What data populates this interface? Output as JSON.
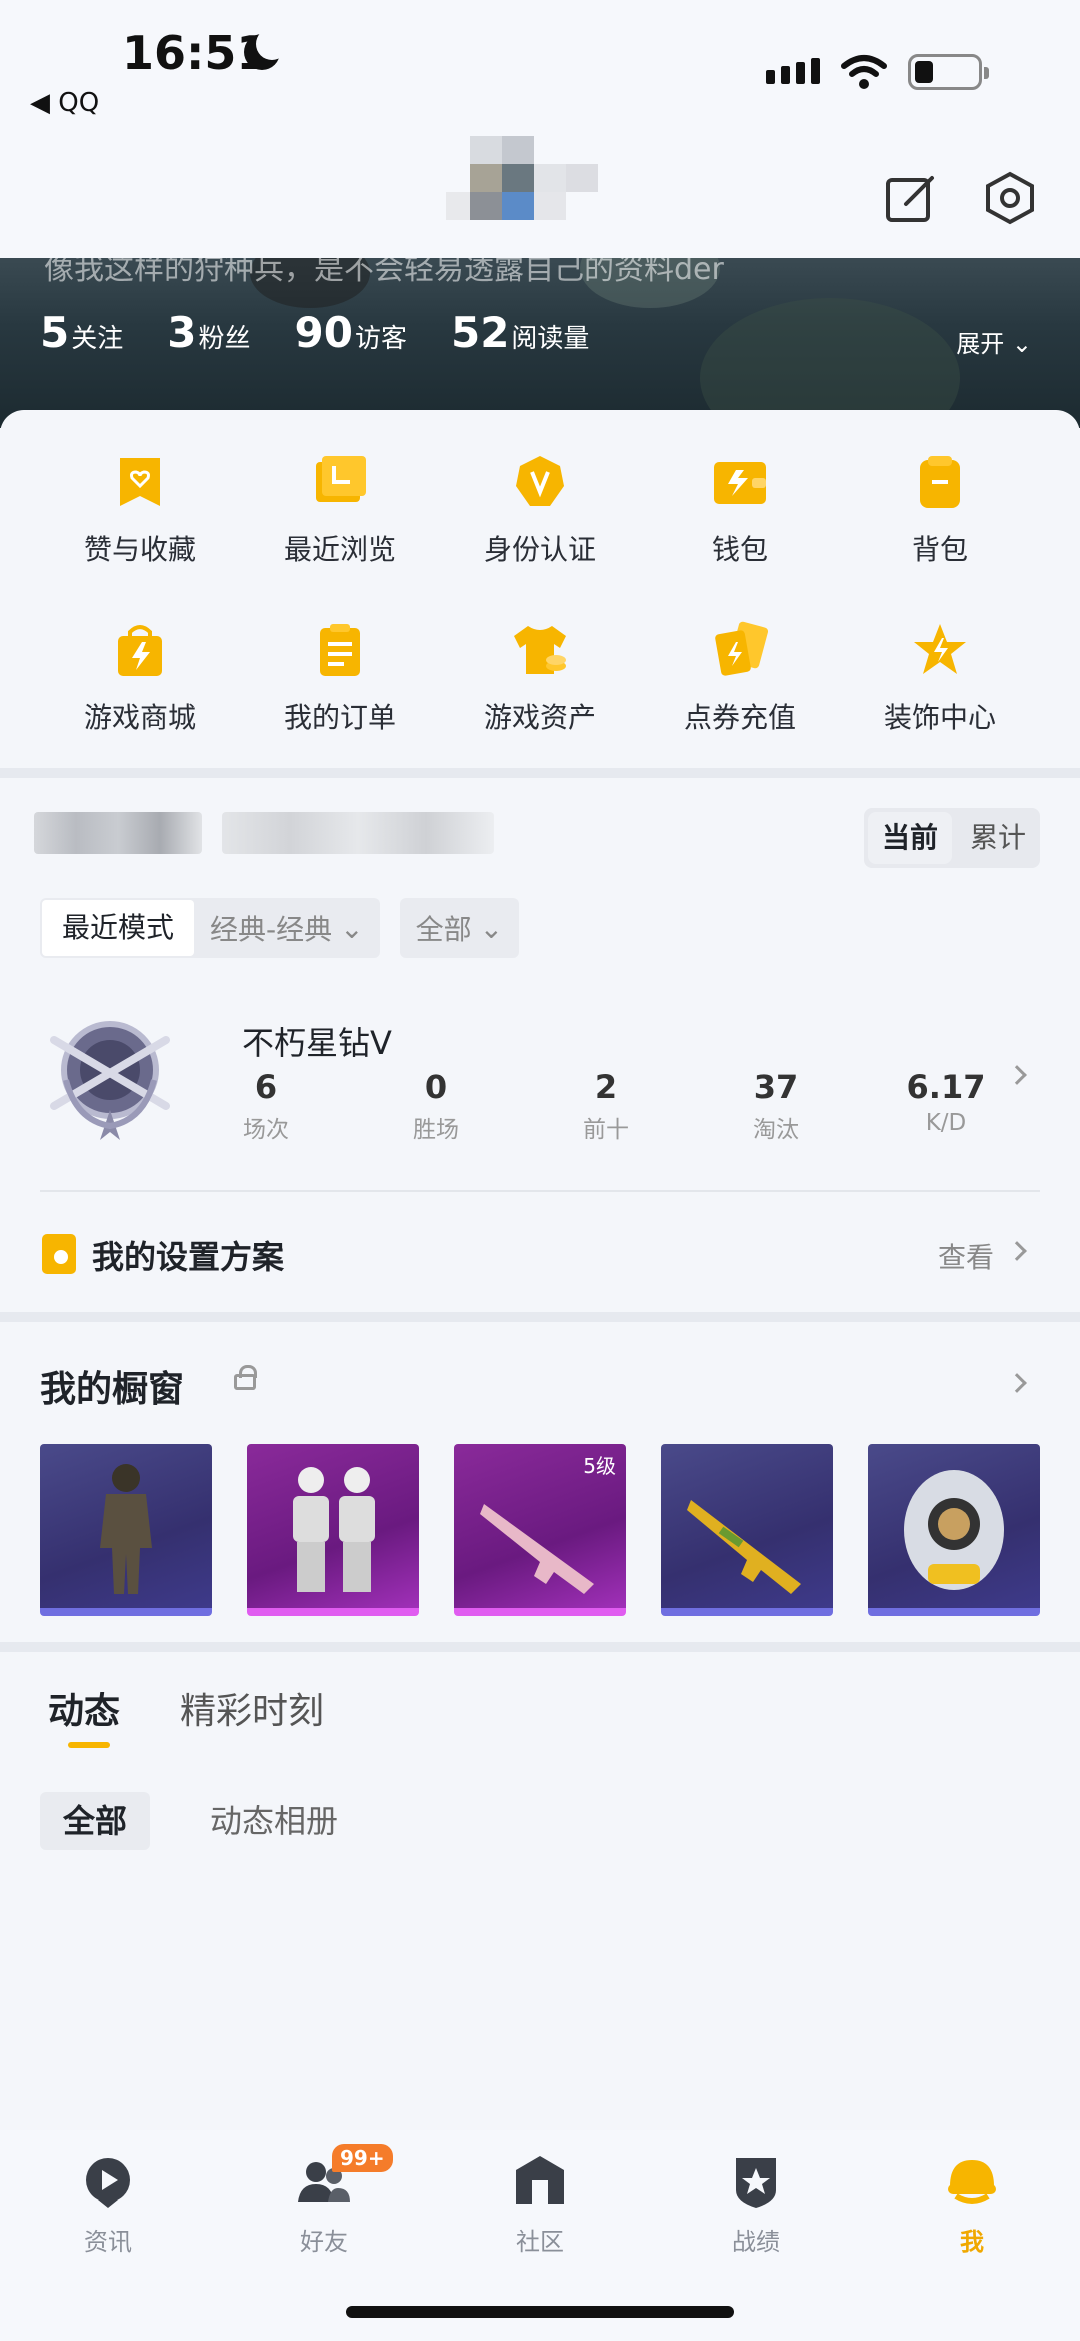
{
  "status_bar": {
    "time": "16:51",
    "back_app": "◀ QQ"
  },
  "profile": {
    "bio": "像我这样的狩种兵，是不会轻易透露自己的资料der",
    "stats": [
      {
        "num": "5",
        "label": "关注"
      },
      {
        "num": "3",
        "label": "粉丝"
      },
      {
        "num": "90",
        "label": "访客"
      },
      {
        "num": "52",
        "label": "阅读量"
      }
    ],
    "expand_label": "展开"
  },
  "menu": {
    "row1": [
      "赞与收藏",
      "最近浏览",
      "身份认证",
      "钱包",
      "背包"
    ],
    "row2": [
      "游戏商城",
      "我的订单",
      "游戏资产",
      "点券充值",
      "装饰中心"
    ]
  },
  "record": {
    "segment": [
      "当前",
      "累计"
    ],
    "mode_selected": "最近模式",
    "mode_option": "经典-经典",
    "scope_option": "全部",
    "rank_title": "不朽星钻Ⅴ",
    "stats": [
      {
        "value": "6",
        "label": "场次"
      },
      {
        "value": "0",
        "label": "胜场"
      },
      {
        "value": "2",
        "label": "前十"
      },
      {
        "value": "37",
        "label": "淘汰"
      },
      {
        "value": "6.17",
        "label": "K/D"
      }
    ],
    "settings_title": "我的设置方案",
    "settings_view": "查看"
  },
  "showcase": {
    "title": "我的橱窗",
    "level_label": "5级"
  },
  "feed": {
    "tabs": [
      "动态",
      "精彩时刻"
    ],
    "subtabs": [
      "全部",
      "动态相册"
    ]
  },
  "bottom_nav": {
    "items": [
      "资讯",
      "好友",
      "社区",
      "战绩",
      "我"
    ],
    "friends_badge": "99+"
  },
  "colors": {
    "accent": "#f7b500",
    "active_nav": "#f0a800"
  }
}
